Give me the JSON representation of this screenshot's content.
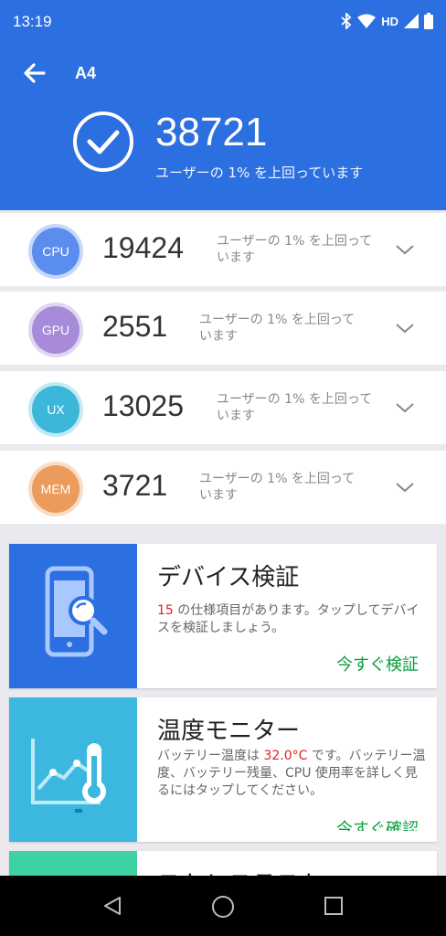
{
  "status_bar": {
    "time": "13:19",
    "network": "HD"
  },
  "header": {
    "title": "A4",
    "total_score": "38721",
    "total_subtitle": "ユーザーの 1% を上回っています"
  },
  "scores": [
    {
      "name": "CPU",
      "score": "19424",
      "desc": "ユーザーの 1% を上回っています",
      "color": "#5b8def"
    },
    {
      "name": "GPU",
      "score": "2551",
      "desc": "ユーザーの 1% を上回っています",
      "color": "#a78bd8"
    },
    {
      "name": "UX",
      "score": "13025",
      "desc": "ユーザーの 1% を上回っています",
      "color": "#3cb7d9"
    },
    {
      "name": "MEM",
      "score": "3721",
      "desc": "ユーザーの 1% を上回っています",
      "color": "#eb9b5c"
    }
  ],
  "cards": {
    "device": {
      "title": "デバイス検証",
      "count": "15",
      "desc_rest": " の仕様項目があります。タップしてデバイスを検証しましょう。",
      "action": "今すぐ検証",
      "color": "#2c6fe0"
    },
    "temp": {
      "title": "温度モニター",
      "desc_pre": "バッテリー温度は ",
      "temperature": "32.0°C",
      "desc_post": " です。バッテリー温度、バッテリー残量、CPU 使用率を詳しく見るにはタップしてください。",
      "action": "今すぐ確認",
      "color": "#3cb7e0"
    },
    "stress": {
      "title": "ストレステスト",
      "color": "#3ed1a4"
    }
  }
}
